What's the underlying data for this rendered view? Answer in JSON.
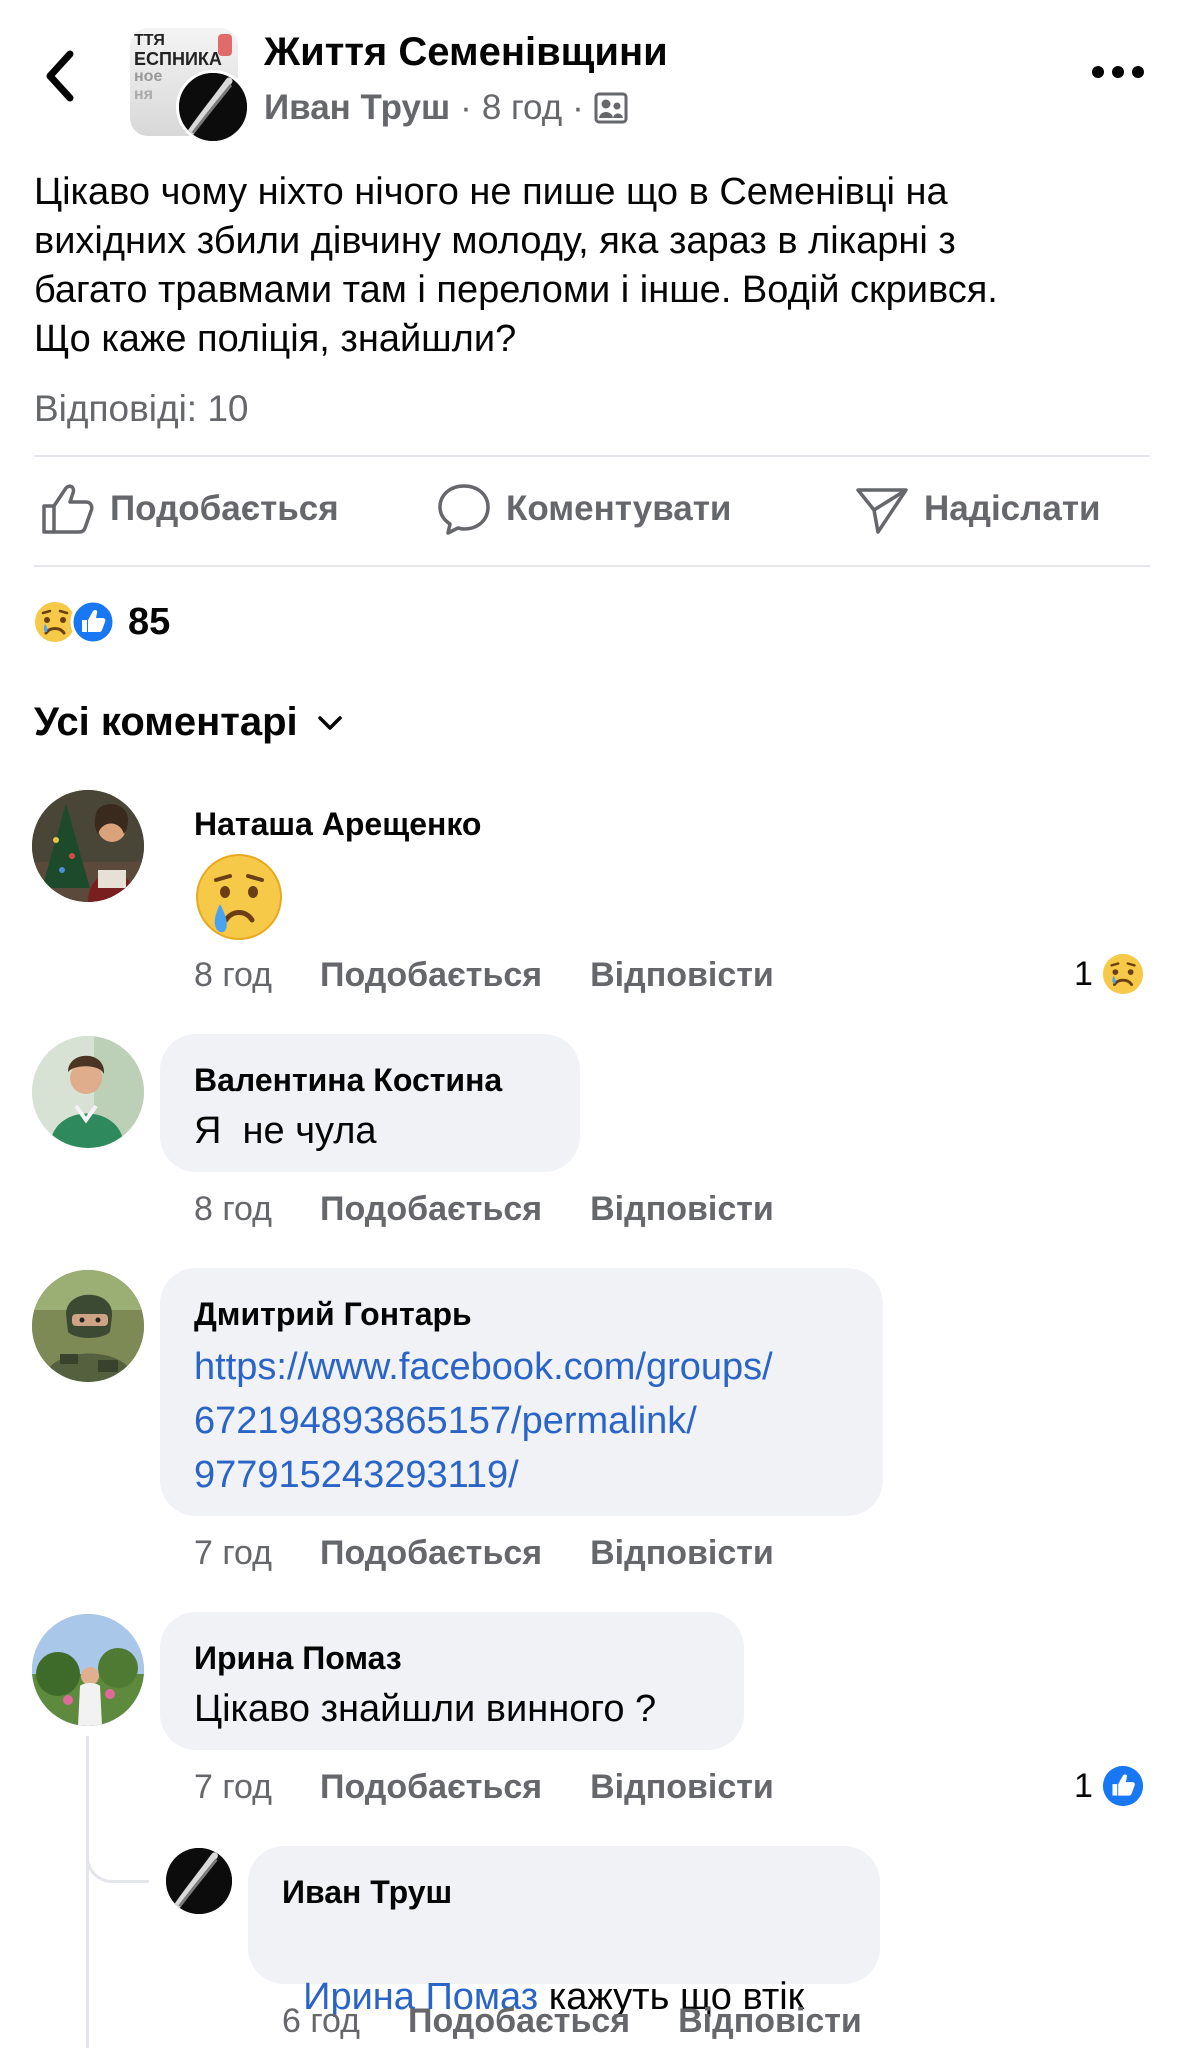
{
  "header": {
    "group_name": "Життя Семенівщини",
    "author": "Иван Труш",
    "separator1": "·",
    "time": "8 год",
    "separator2": "·",
    "back_icon": "chevron-left-icon",
    "more_icon": "more-horizontal-icon",
    "privacy_icon": "group-members-icon",
    "group_avatar_text": [
      "ТТЯ",
      "ЕСПНИКА",
      "ное",
      "ня"
    ]
  },
  "post": {
    "lines": [
      "Цікаво чому ніхто нічого не пише що в Семенівці на",
      "вихідних збили дівчину молоду, яка зараз в лікарні з",
      "багато травмами там і переломи і інше. Водій скрився.",
      "Що каже поліція, знайшли?"
    ],
    "replies_count": "Відповіді: 10"
  },
  "actions": {
    "like": "Подобається",
    "comment": "Коментувати",
    "share": "Надіслати"
  },
  "reactions": {
    "count": "85",
    "types": [
      "sad",
      "like"
    ]
  },
  "comments_filter": {
    "label": "Усі коментарі"
  },
  "comments": [
    {
      "name": "Наташа Арещенко",
      "emoji": "😢",
      "time": "8 год",
      "like": "Подобається",
      "reply": "Відповісти",
      "reaction_count": "1",
      "reaction_type": "sad"
    },
    {
      "name": "Валентина Костина",
      "text": "Я  не чула",
      "time": "8 год",
      "like": "Подобається",
      "reply": "Відповісти"
    },
    {
      "name": "Дмитрий Гонтарь",
      "link_lines": [
        "https://www.facebook.com/groups/",
        "672194893865157/permalink/",
        "977915243293119/"
      ],
      "time": "7 год",
      "like": "Подобається",
      "reply": "Відповісти"
    },
    {
      "name": "Ирина Помаз",
      "text": "Цікаво знайшли винного ?",
      "time": "7 год",
      "like": "Подобається",
      "reply": "Відповісти",
      "reaction_count": "1",
      "reaction_type": "like"
    }
  ],
  "reply": {
    "name": "Иван Труш",
    "mention": "Ирина Помаз",
    "text": " кажуть що втік",
    "time": "6 год",
    "like": "Подобається",
    "reply": "Відповісти"
  },
  "colors": {
    "link": "#2a64c6",
    "muted": "#65676b",
    "bubble": "#f0f2f5",
    "like_blue": "#1877f2",
    "sad_yellow": "#f7c948"
  }
}
